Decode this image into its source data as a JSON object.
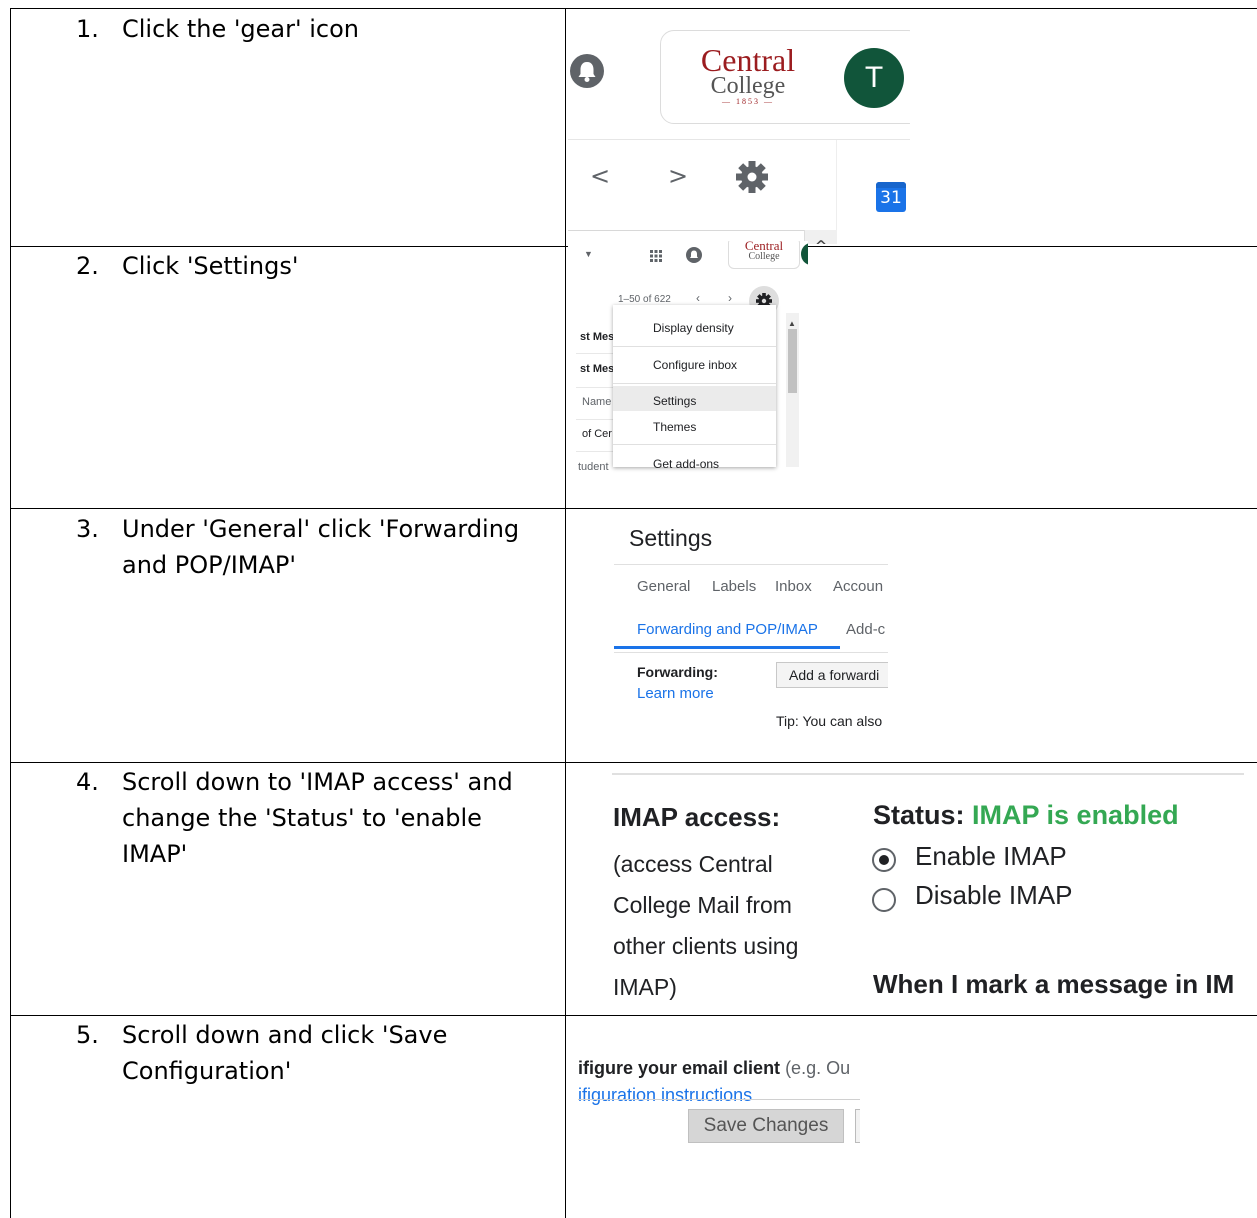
{
  "steps": [
    {
      "number": "1.",
      "lines": [
        "Click the 'gear' icon"
      ]
    },
    {
      "number": "2.",
      "lines": [
        "Click 'Settings'"
      ]
    },
    {
      "number": "3.",
      "lines": [
        "Under 'General' click 'Forwarding",
        "and POP/IMAP'"
      ]
    },
    {
      "number": "4.",
      "lines": [
        "Scroll down to 'IMAP access' and",
        "change the 'Status' to 'enable",
        "IMAP'"
      ]
    },
    {
      "number": "5.",
      "lines": [
        "Scroll down and click 'Save",
        "Configuration'"
      ]
    }
  ],
  "shot1": {
    "logo_line1": "Central",
    "logo_line2": "College",
    "logo_year": "1853",
    "avatar_letter": "T",
    "prev_glyph": "<",
    "next_glyph": ">",
    "calendar_day": "31",
    "scroll_glyph": "^",
    "icons": [
      "bell-icon",
      "gear-icon",
      "calendar-icon",
      "chevron-left-icon",
      "chevron-right-icon"
    ],
    "colors": {
      "logo_red": "#9b1c1f",
      "avatar_green": "#11553a"
    }
  },
  "shot2": {
    "logo_line1": "Central",
    "logo_line2": "College",
    "pagination": "1–50 of 622",
    "menu_items": [
      "Display density",
      "Configure inbox",
      "Settings",
      "Themes",
      "Get add-ons"
    ],
    "left_fragments": [
      "st Mes",
      "st Mes",
      "Name",
      "of Cer",
      "tudent"
    ]
  },
  "shot3": {
    "title": "Settings",
    "tabs_row1": [
      "General",
      "Labels",
      "Inbox",
      "Accoun"
    ],
    "tabs_row2": [
      "Forwarding and POP/IMAP",
      "Add-c"
    ],
    "forwarding_label": "Forwarding:",
    "learn_more": "Learn more",
    "add_button": "Add a forwardi",
    "tip": "Tip: You can also"
  },
  "shot4": {
    "imap_label": "IMAP access:",
    "description_lines": [
      "(access Central",
      "College Mail from",
      "other clients using",
      "IMAP)"
    ],
    "status_prefix": "Status: ",
    "status_value": "IMAP is enabled",
    "option_enable": "Enable IMAP",
    "option_disable": "Disable IMAP",
    "selected": "Enable IMAP",
    "footer": "When I mark a message in IM",
    "colors": {
      "status_green": "#34a853"
    }
  },
  "shot5": {
    "configure_bold": "ifigure your email client",
    "configure_rest": " (e.g. Ou",
    "instructions_link": "ifiguration instructions",
    "save_button": "Save Changes"
  }
}
